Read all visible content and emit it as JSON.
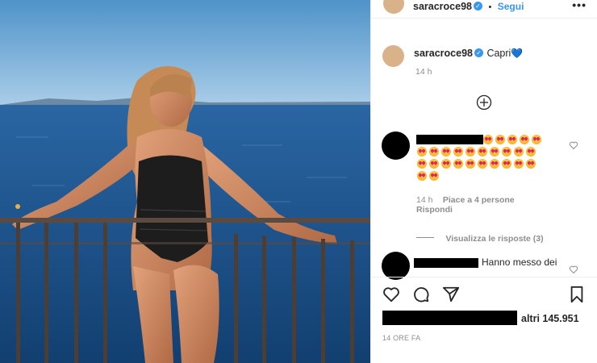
{
  "post": {
    "username": "saracroce98",
    "follow_label": "Segui",
    "more_label": "•••",
    "verified_mark": "✓"
  },
  "caption": {
    "username": "saracroce98",
    "text": "Capri",
    "emoji": "💙",
    "age": "14 h"
  },
  "add_icon": "plus-circle-icon",
  "comments": [
    {
      "age": "14 h",
      "likes": "Piace a 4 persone",
      "reply_label": "Rispondi",
      "view_replies": "Visualizza le risposte (3)"
    },
    {
      "text": "Hanno messo dei"
    }
  ],
  "actions": {
    "like_icon": "heart-icon",
    "comment_icon": "comment-icon",
    "share_icon": "paper-plane-icon",
    "save_icon": "bookmark-icon"
  },
  "likes_line": {
    "others": "altri 145.951"
  },
  "timestamp": "14 ORE FA",
  "colors": {
    "accent": "#3897f0",
    "sea": "#1d4f86",
    "sky": "#7fb3d8"
  }
}
